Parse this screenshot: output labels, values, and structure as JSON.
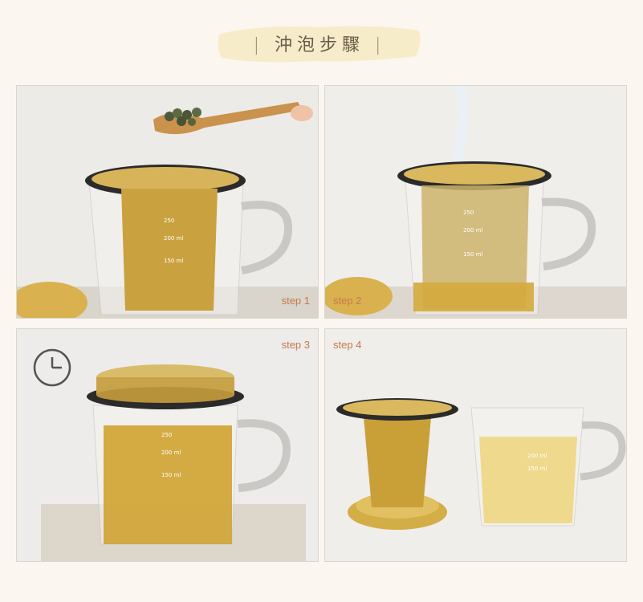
{
  "title": {
    "text": "沖泡步驟",
    "bar_left": "|",
    "bar_right": "|"
  },
  "steps": [
    {
      "label": "step 1"
    },
    {
      "label": "step 2"
    },
    {
      "label": "step 3"
    },
    {
      "label": "step 4"
    }
  ],
  "scale_marks": [
    "250",
    "200 ml",
    "150 ml"
  ],
  "colors": {
    "accent": "#c47a4a",
    "gold": "#d4b050",
    "panel": "#e9e6e2",
    "background": "#fbf6ef"
  }
}
